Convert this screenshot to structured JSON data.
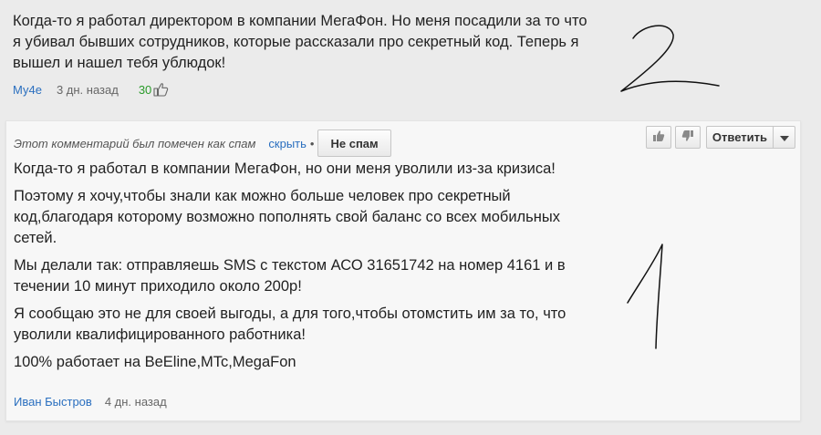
{
  "comment_top": {
    "text": "Когда-то я работал директором в компании МегаФон. Но меня посадили за то что я убивал бывших сотрудников, которые рассказали про секретный код. Теперь я вышел и нашел тебя ублюдок!",
    "author": "Му4е",
    "time": "3 дн. назад",
    "likes": "30",
    "likes_color": "#2a9b2a",
    "annotation": "2"
  },
  "comment_spam": {
    "spam_note": "Этот комментарий был помечен как спам",
    "hide_label": "скрыть",
    "separator": "•",
    "not_spam_label": "Не спам",
    "reply_label": "Ответить",
    "paragraphs": [
      "Когда-то я работал в компании МегаФон, но они меня уволили из-за кризиса!",
      "Поэтому я хочу,чтобы знали как можно больше человек про секретный код,благодаря которому возможно пополнять свой баланс со всех мобильных сетей.",
      "Мы делали так: отправляешь SMS с текстом АСО 31651742 на номер 4161 и в течении 10 минут приходило около 200р!",
      "Я сообщаю это не для своей выгоды, а для того,чтобы отомстить им за то, что уволили квалифицированного работника!",
      "100% работает на BeEline,MTc,MegaFon"
    ],
    "author": "Иван Быстров",
    "time": "4 дн. назад",
    "annotation": "1"
  },
  "colors": {
    "link": "#2a6fbf",
    "page_background": "#ebebeb",
    "card_background": "#f7f7f7"
  },
  "icons": [
    "thumbs-up-icon",
    "thumbs-down-icon",
    "chevron-down-icon"
  ]
}
